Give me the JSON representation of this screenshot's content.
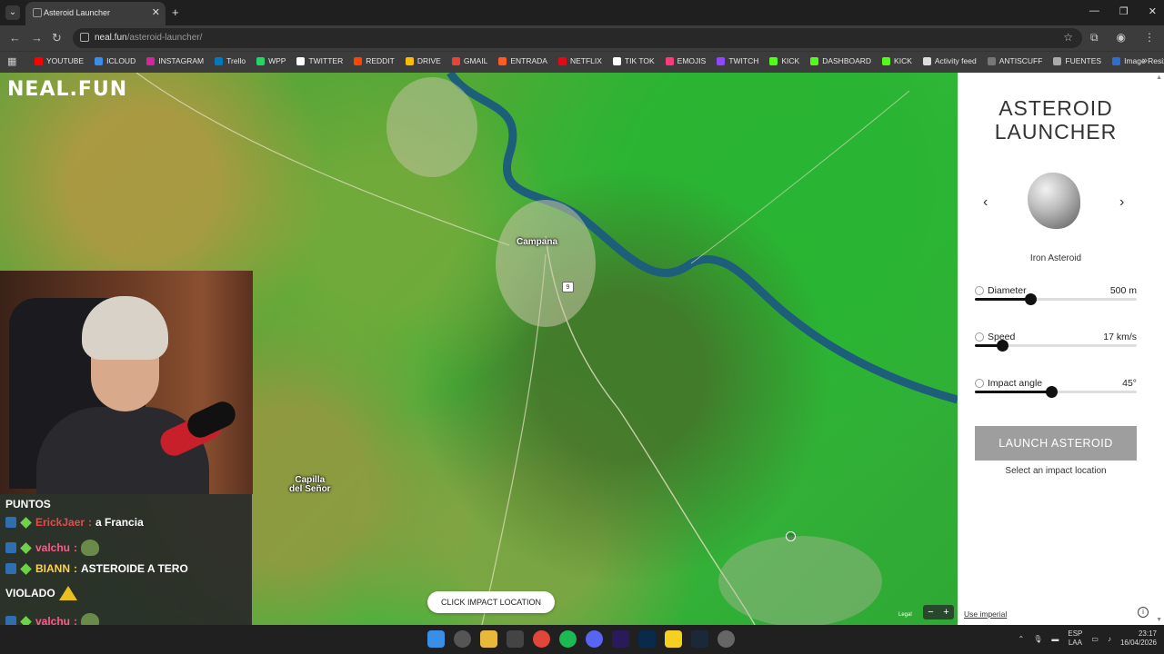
{
  "browser": {
    "tab_title": "Asteroid Launcher",
    "url_domain": "neal.fun",
    "url_path": "/asteroid-launcher/",
    "bookmarks": [
      {
        "label": "YOUTUBE",
        "color": "#ff0000"
      },
      {
        "label": "ICLOUD",
        "color": "#3b8ee8"
      },
      {
        "label": "INSTAGRAM",
        "color": "#d6249f"
      },
      {
        "label": "Trello",
        "color": "#0079bf"
      },
      {
        "label": "WPP",
        "color": "#25d366"
      },
      {
        "label": "TWITTER",
        "color": "#ffffff"
      },
      {
        "label": "REDDIT",
        "color": "#ff4500"
      },
      {
        "label": "DRIVE",
        "color": "#fbbc04"
      },
      {
        "label": "GMAIL",
        "color": "#ea4335"
      },
      {
        "label": "ENTRADA",
        "color": "#ff5a1f"
      },
      {
        "label": "NETFLIX",
        "color": "#e50914"
      },
      {
        "label": "TIK TOK",
        "color": "#ffffff"
      },
      {
        "label": "EMOJIS",
        "color": "#ff3a7a"
      },
      {
        "label": "TWITCH",
        "color": "#9146ff"
      },
      {
        "label": "KICK",
        "color": "#53fc18"
      },
      {
        "label": "DASHBOARD",
        "color": "#53fc18"
      },
      {
        "label": "KICK",
        "color": "#53fc18"
      },
      {
        "label": "Activity feed",
        "color": "#dddddd"
      },
      {
        "label": "ANTISCUFF",
        "color": "#777777"
      },
      {
        "label": "FUENTES",
        "color": "#aaaaaa"
      },
      {
        "label": "Image Resizer | Resi...",
        "color": "#2c6ed5"
      }
    ]
  },
  "map": {
    "logo": "NEAL.FUN",
    "labels": {
      "campana": "Campana",
      "capilla": "Capilla\ndel Señor"
    },
    "route_number": "9",
    "click_prompt": "CLICK IMPACT LOCATION",
    "legal": "Legal",
    "zoom_out": "−",
    "zoom_in": "+"
  },
  "chat": {
    "header": "PUNTOS",
    "messages": [
      {
        "user": "ErickJaer",
        "user_color": "#e84a4a",
        "text": "a Francia"
      },
      {
        "user": "valchu",
        "user_color": "#ff5a8a",
        "text": ""
      },
      {
        "user": "BIANN",
        "user_color": "#ffd24a",
        "text": "ASTEROIDE A TERO"
      },
      {
        "user": "",
        "user_color": "#ffffff",
        "text": "VIOLADO"
      },
      {
        "user": "valchu",
        "user_color": "#ff5a8a",
        "text": ""
      },
      {
        "user": "valchu",
        "user_color": "#ff5a8a",
        "text": ""
      }
    ]
  },
  "panel": {
    "title_line1": "ASTEROID",
    "title_line2": "LAUNCHER",
    "prev": "‹",
    "next": "›",
    "asteroid_name": "Iron Asteroid",
    "params": [
      {
        "label": "Diameter",
        "value": "500 m",
        "fraction": 0.34
      },
      {
        "label": "Speed",
        "value": "17 km/s",
        "fraction": 0.17
      },
      {
        "label": "Impact angle",
        "value": "45°",
        "fraction": 0.47
      }
    ],
    "launch_label": "LAUNCH ASTEROID",
    "hint": "Select an impact location",
    "use_imperial": "Use imperial",
    "info": "i"
  },
  "taskbar": {
    "lang_line1": "ESP",
    "lang_line2": "LAA",
    "time": "23:17",
    "date": "16/04/2026"
  }
}
